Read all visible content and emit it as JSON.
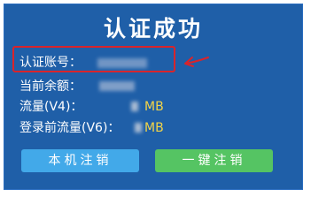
{
  "panel": {
    "title": "认证成功",
    "account_label": "认证账号：",
    "balance_label": "当前余额：",
    "flow_v4_label": "流量(V4)：",
    "flow_v4_unit": "MB",
    "flow_v6_label": "登录前流量(V6)：",
    "flow_v6_unit": "MB"
  },
  "buttons": {
    "logout_local": "本机注销",
    "logout_all": "一键注销"
  },
  "colors": {
    "panel": "#1f5fa8",
    "highlight": "#d9242b",
    "unit": "#f3d447",
    "button_local": "#42a9e9",
    "button_all": "#55c463"
  }
}
